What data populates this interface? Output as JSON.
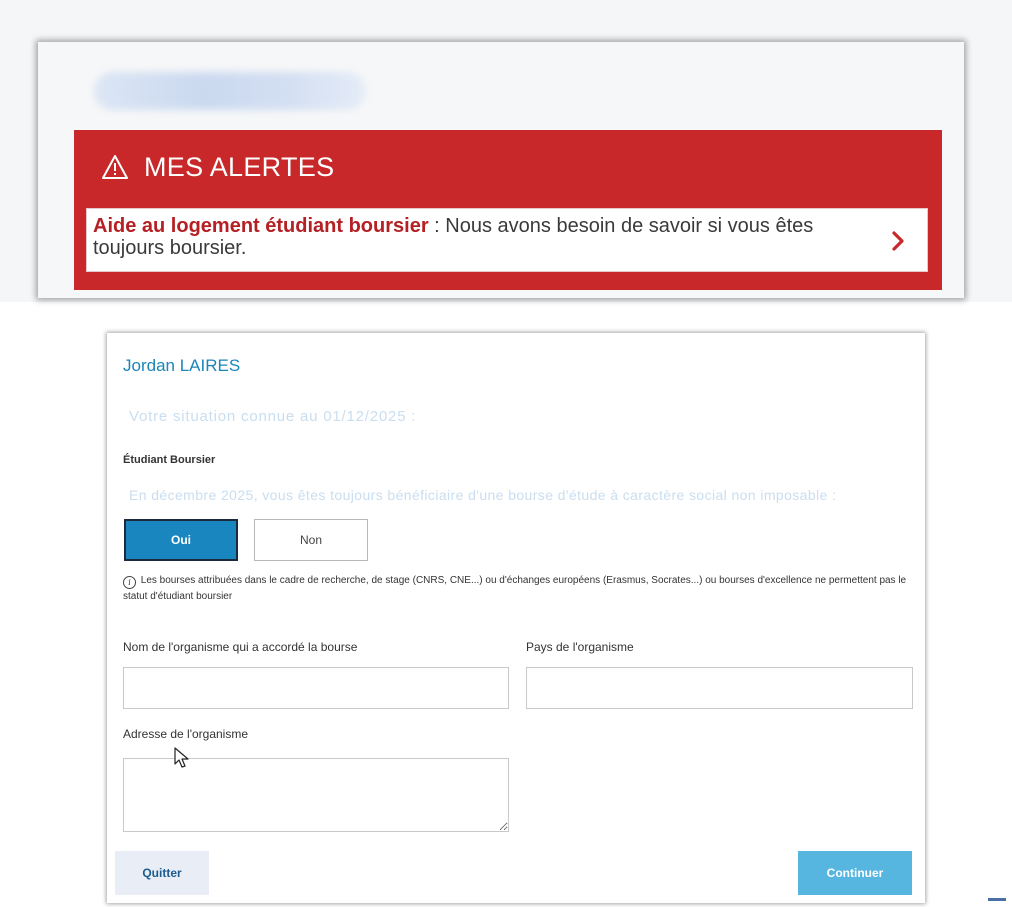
{
  "alerts": {
    "icon": "warning-triangle-icon",
    "title": "MES ALERTES",
    "item": {
      "strong": "Aide au logement étudiant boursier",
      "text": " : Nous avons besoin de savoir si vous êtes toujours boursier.",
      "chevron_icon": "chevron-right-icon"
    },
    "colors": {
      "background": "#c9282a",
      "strong_text": "#b52024"
    }
  },
  "form": {
    "user_name": "Jordan LAIRES",
    "situation_title": "Votre situation connue au 01/12/2025 :",
    "status_label": "Étudiant Boursier",
    "question": "En décembre 2025, vous êtes toujours bénéficiaire d'une bourse d'étude à caractère social non imposable :",
    "options": {
      "yes": "Oui",
      "no": "Non",
      "selected": "Oui"
    },
    "info_icon": "info-circle-icon",
    "info_note": "Les bourses attribuées dans le cadre de recherche, de stage (CNRS, CNE...) ou d'échanges européens (Erasmus, Socrates...) ou bourses d'excellence ne permettent pas le statut d'étudiant boursier",
    "fields": {
      "org_name": {
        "label": "Nom de l'organisme qui a accordé la bourse",
        "value": ""
      },
      "org_country": {
        "label": "Pays de l'organisme",
        "value": ""
      },
      "org_address": {
        "label": "Adresse de l'organisme",
        "value": ""
      }
    },
    "buttons": {
      "quit": "Quitter",
      "continue": "Continuer"
    },
    "colors": {
      "primary": "#1a86c0",
      "continue": "#56b6e0",
      "link": "#1a86b9"
    }
  }
}
